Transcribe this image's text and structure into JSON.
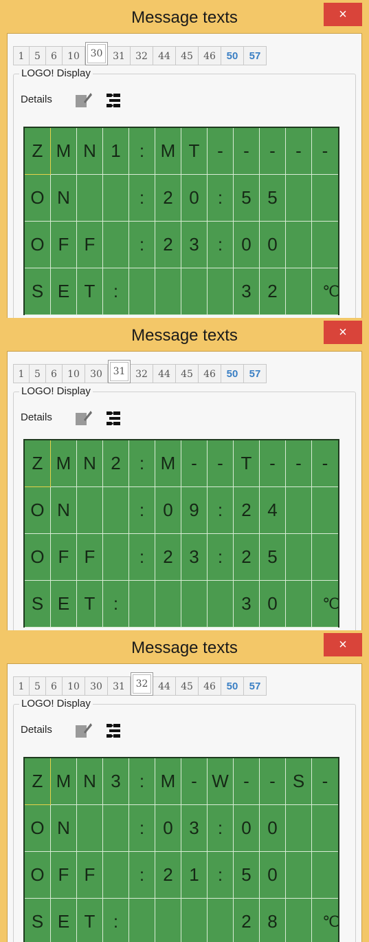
{
  "windows": [
    {
      "title": "Message texts",
      "close_label": "×",
      "active_tab": "30",
      "group_label": "LOGO! Display",
      "details_label": "Details",
      "rows": [
        [
          "Z",
          "M",
          "N",
          "1",
          ":",
          "M",
          "T",
          "-",
          "-",
          "-",
          "-",
          "-"
        ],
        [
          "O",
          "N",
          "",
          "",
          ":",
          "2",
          "0",
          ":",
          "5",
          "5",
          "",
          ""
        ],
        [
          "O",
          "F",
          "F",
          "",
          ":",
          "2",
          "3",
          ":",
          "0",
          "0",
          "",
          ""
        ],
        [
          "S",
          "E",
          "T",
          ":",
          "",
          "",
          "",
          "",
          "3",
          "2",
          "",
          "℃"
        ]
      ]
    },
    {
      "title": "Message texts",
      "close_label": "×",
      "active_tab": "31",
      "group_label": "LOGO! Display",
      "details_label": "Details",
      "rows": [
        [
          "Z",
          "M",
          "N",
          "2",
          ":",
          "M",
          "-",
          "-",
          "T",
          "-",
          "-",
          "-"
        ],
        [
          "O",
          "N",
          "",
          "",
          ":",
          "0",
          "9",
          ":",
          "2",
          "4",
          "",
          ""
        ],
        [
          "O",
          "F",
          "F",
          "",
          ":",
          "2",
          "3",
          ":",
          "2",
          "5",
          "",
          ""
        ],
        [
          "S",
          "E",
          "T",
          ":",
          "",
          "",
          "",
          "",
          "3",
          "0",
          "",
          "℃"
        ]
      ]
    },
    {
      "title": "Message texts",
      "close_label": "×",
      "active_tab": "32",
      "group_label": "LOGO! Display",
      "details_label": "Details",
      "rows": [
        [
          "Z",
          "M",
          "N",
          "3",
          ":",
          "M",
          "-",
          "W",
          "-",
          "-",
          "S",
          "-"
        ],
        [
          "O",
          "N",
          "",
          "",
          ":",
          "0",
          "3",
          ":",
          "0",
          "0",
          "",
          ""
        ],
        [
          "O",
          "F",
          "F",
          "",
          ":",
          "2",
          "1",
          ":",
          "5",
          "0",
          "",
          ""
        ],
        [
          "S",
          "E",
          "T",
          ":",
          "",
          "",
          "",
          "",
          "2",
          "8",
          "",
          "℃"
        ]
      ]
    }
  ],
  "tabs": [
    "1",
    "5",
    "6",
    "10",
    "30",
    "31",
    "32",
    "44",
    "45",
    "46",
    "50",
    "57"
  ],
  "blue_tabs": [
    "50",
    "57"
  ],
  "colors": {
    "frame": "#f3c768",
    "close": "#d9443a",
    "lcd": "#4b9b4f",
    "tab_blue": "#3a7fc4"
  },
  "icons": {
    "details": "edit-tool-icon",
    "view": "flow-toggle-icon"
  }
}
